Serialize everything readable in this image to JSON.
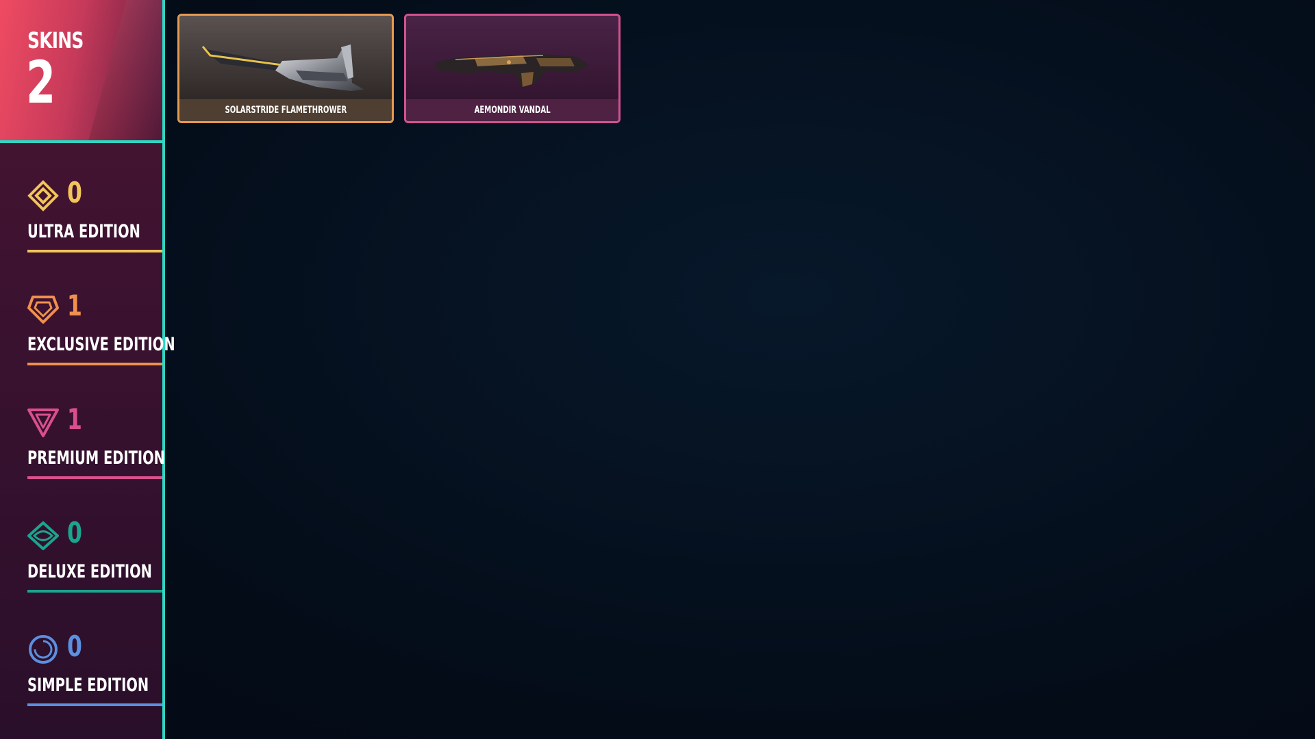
{
  "header": {
    "label": "SKINS",
    "count": "2"
  },
  "editions": [
    {
      "count": "0",
      "label": "ULTRA EDITION",
      "color": "#f2c45a",
      "icon": "ultra-diamond-icon"
    },
    {
      "count": "1",
      "label": "EXCLUSIVE EDITION",
      "color": "#f0904f",
      "icon": "exclusive-pentagon-icon"
    },
    {
      "count": "1",
      "label": "PREMIUM EDITION",
      "color": "#d94f8d",
      "icon": "premium-triangle-icon"
    },
    {
      "count": "0",
      "label": "DELUXE EDITION",
      "color": "#1aa58e",
      "icon": "deluxe-rhombus-icon"
    },
    {
      "count": "0",
      "label": "SIMPLE EDITION",
      "color": "#5b8fe0",
      "icon": "simple-circle-icon"
    }
  ],
  "skins": [
    {
      "name": "SOLARSTRIDE FLAMETHROWER",
      "edition": "Exclusive",
      "border_color": "#e59a52"
    },
    {
      "name": "AEMONDIR VANDAL",
      "edition": "Premium",
      "border_color": "#d2528f"
    }
  ],
  "colors": {
    "accent": "#2fd6c3",
    "header_gradient_start": "#ef4b62",
    "background": "#050f1b"
  }
}
